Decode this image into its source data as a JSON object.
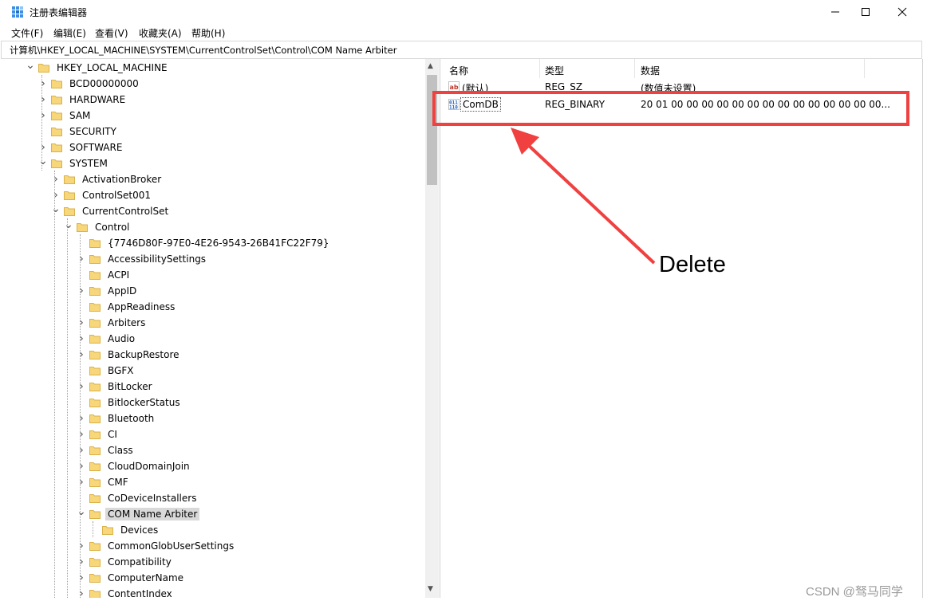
{
  "window": {
    "title": "注册表编辑器",
    "minimize": "—",
    "maximize": "☐",
    "close": "✕"
  },
  "menu": [
    "文件(F)",
    "编辑(E)",
    "查看(V)",
    "收藏夹(A)",
    "帮助(H)"
  ],
  "address": "计算机\\HKEY_LOCAL_MACHINE\\SYSTEM\\CurrentControlSet\\Control\\COM Name Arbiter",
  "tree": [
    {
      "label": "HKEY_LOCAL_MACHINE",
      "expander": "down"
    },
    {
      "label": "BCD00000000",
      "expander": "right"
    },
    {
      "label": "HARDWARE",
      "expander": "right"
    },
    {
      "label": "SAM",
      "expander": "right"
    },
    {
      "label": "SECURITY",
      "expander": "none"
    },
    {
      "label": "SOFTWARE",
      "expander": "right"
    },
    {
      "label": "SYSTEM",
      "expander": "down"
    },
    {
      "label": "ActivationBroker",
      "expander": "right"
    },
    {
      "label": "ControlSet001",
      "expander": "right"
    },
    {
      "label": "CurrentControlSet",
      "expander": "down"
    },
    {
      "label": "Control",
      "expander": "down"
    },
    {
      "label": "{7746D80F-97E0-4E26-9543-26B41FC22F79}",
      "expander": "none"
    },
    {
      "label": "AccessibilitySettings",
      "expander": "right"
    },
    {
      "label": "ACPI",
      "expander": "none"
    },
    {
      "label": "AppID",
      "expander": "right"
    },
    {
      "label": "AppReadiness",
      "expander": "none"
    },
    {
      "label": "Arbiters",
      "expander": "right"
    },
    {
      "label": "Audio",
      "expander": "right"
    },
    {
      "label": "BackupRestore",
      "expander": "right"
    },
    {
      "label": "BGFX",
      "expander": "none"
    },
    {
      "label": "BitLocker",
      "expander": "right"
    },
    {
      "label": "BitlockerStatus",
      "expander": "none"
    },
    {
      "label": "Bluetooth",
      "expander": "right"
    },
    {
      "label": "CI",
      "expander": "right"
    },
    {
      "label": "Class",
      "expander": "right"
    },
    {
      "label": "CloudDomainJoin",
      "expander": "right"
    },
    {
      "label": "CMF",
      "expander": "right"
    },
    {
      "label": "CoDeviceInstallers",
      "expander": "none"
    },
    {
      "label": "COM Name Arbiter",
      "expander": "down",
      "selected": true
    },
    {
      "label": "Devices",
      "expander": "none"
    },
    {
      "label": "CommonGlobUserSettings",
      "expander": "right"
    },
    {
      "label": "Compatibility",
      "expander": "right"
    },
    {
      "label": "ComputerName",
      "expander": "right"
    },
    {
      "label": "ContentIndex",
      "expander": "right"
    }
  ],
  "list": {
    "columns": [
      "名称",
      "类型",
      "数据"
    ],
    "rows": [
      {
        "name": "(默认)",
        "type": "REG_SZ",
        "data": "(数值未设置)",
        "icon": "string-value-icon"
      },
      {
        "name": "ComDB",
        "type": "REG_BINARY",
        "data": "20 01 00 00 00 00 00 00 00 00 00 00 00 00 00 00...",
        "icon": "binary-value-icon"
      }
    ]
  },
  "annotation": {
    "text": "Delete",
    "color": "#f04040"
  },
  "watermark": "CSDN @驽马同学",
  "colors": {
    "selection": "#d9d9d9",
    "folder": "#f7d77a",
    "accent_red": "#f04040"
  }
}
